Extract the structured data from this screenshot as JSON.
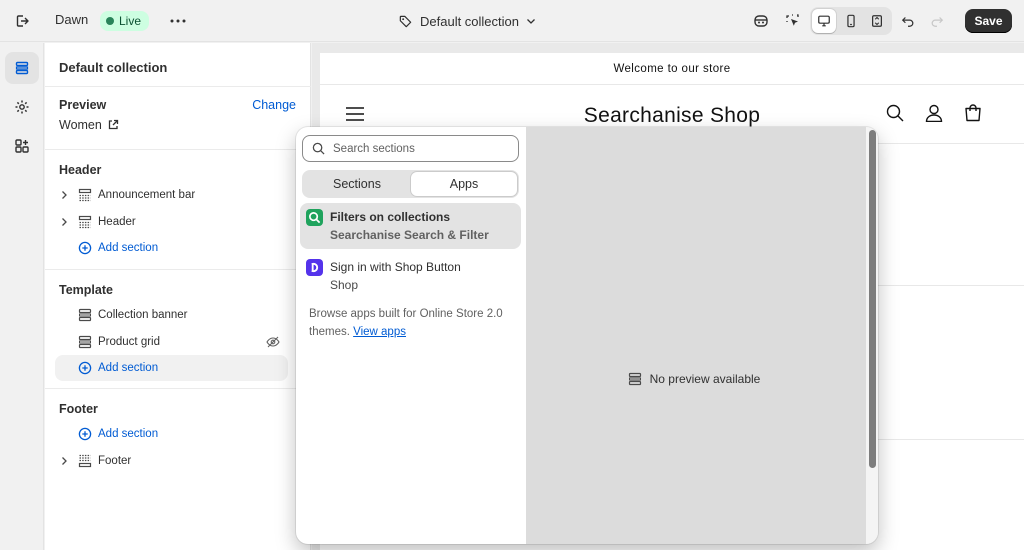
{
  "topbar": {
    "theme_name": "Dawn",
    "live_label": "Live",
    "template_label": "Default collection",
    "save_label": "Save"
  },
  "sidebar": {
    "title": "Default collection",
    "preview": {
      "label": "Preview",
      "change_label": "Change",
      "value": "Women"
    },
    "header_group": {
      "title": "Header",
      "items": [
        "Announcement bar",
        "Header"
      ],
      "add_label": "Add section"
    },
    "template_group": {
      "title": "Template",
      "items": [
        "Collection banner",
        "Product grid"
      ],
      "add_label": "Add section"
    },
    "footer_group": {
      "title": "Footer",
      "add_label": "Add section",
      "items": [
        "Footer"
      ]
    }
  },
  "store": {
    "announcement": "Welcome to our store",
    "name": "Searchanise Shop"
  },
  "picker": {
    "search_placeholder": "Search sections",
    "tabs": [
      "Sections",
      "Apps"
    ],
    "active_tab": "Apps",
    "apps": [
      {
        "title": "Filters on collections",
        "subtitle": "Searchanise Search & Filter",
        "color": "#1fa35d"
      },
      {
        "title": "Sign in with Shop Button",
        "subtitle": "Shop",
        "color": "#5433eb"
      }
    ],
    "browse_text": "Browse apps built for Online Store 2.0 themes.",
    "view_apps_label": "View apps",
    "no_preview": "No preview available"
  },
  "colors": {
    "accent": "#005bd3",
    "live_bg": "#cdfee1",
    "live_dot": "#29845a"
  }
}
